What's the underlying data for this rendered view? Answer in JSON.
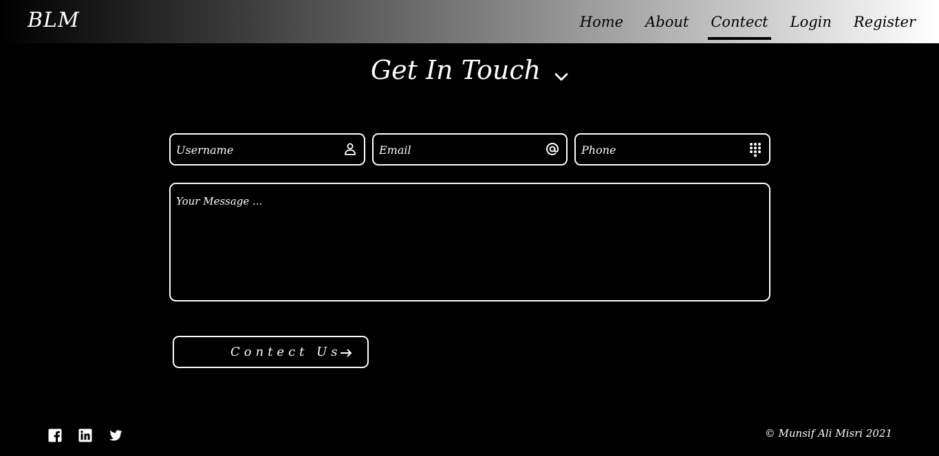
{
  "brand": "BLM",
  "nav": {
    "items": [
      {
        "label": "Home"
      },
      {
        "label": "About"
      },
      {
        "label": "Contect"
      },
      {
        "label": "Login"
      },
      {
        "label": "Register"
      }
    ],
    "active": "Contect"
  },
  "heading": "Get In Touch",
  "form": {
    "username_placeholder": "Username",
    "email_placeholder": "Email",
    "phone_placeholder": "Phone",
    "message_placeholder": "Your Message ...",
    "submit_label": "Contect Us"
  },
  "icons": {
    "username": "user-icon",
    "email": "at-sign-icon",
    "phone": "dialpad-icon",
    "submit": "arrow-right-icon",
    "heading": "chevron-down-icon"
  },
  "footer": {
    "social": [
      "facebook",
      "linkedin",
      "twitter"
    ],
    "copyright": "© Munsif Ali Misri 2021"
  },
  "colors": {
    "background": "#000000",
    "foreground": "#ffffff",
    "nav_text": "#000000"
  }
}
